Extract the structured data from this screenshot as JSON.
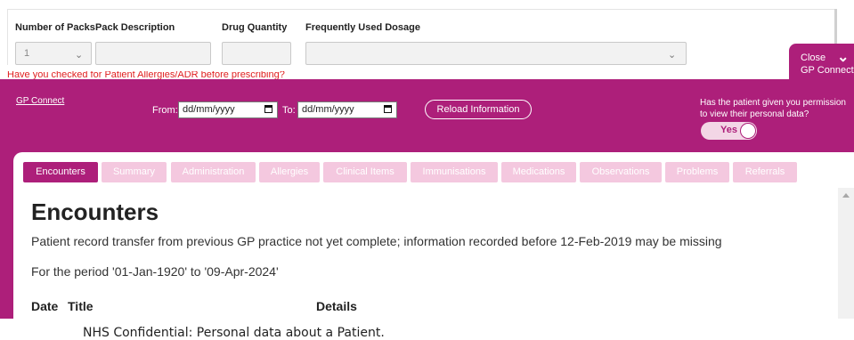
{
  "form": {
    "labels": {
      "packs": "Number of Packs",
      "description": "Pack Description",
      "quantity": "Drug Quantity",
      "dosage": "Frequently Used Dosage"
    },
    "packs_value": "1",
    "description_value": "",
    "quantity_value": "",
    "dosage_value": ""
  },
  "warning": "Have you checked for Patient Allergies/ADR before prescribing?",
  "close_tab": {
    "line1": "Close",
    "line2": "GP Connect"
  },
  "gp_panel": {
    "link": "GP Connect",
    "from_label": "From:",
    "to_label": "To:",
    "from_placeholder": "dd/mm/yyyy",
    "to_placeholder": "dd/mm/yyyy",
    "reload": "Reload Information",
    "permission": "Has the patient given you permission to view their personal data?",
    "toggle": "Yes"
  },
  "tabs": [
    "Encounters",
    "Summary",
    "Administration",
    "Allergies",
    "Clinical Items",
    "Immunisations",
    "Medications",
    "Observations",
    "Problems",
    "Referrals"
  ],
  "content": {
    "heading": "Encounters",
    "notice": "Patient record transfer from previous GP practice not yet complete; information recorded before 12-Feb-2019 may be missing",
    "period": "For the period '01-Jan-1920' to '09-Apr-2024'",
    "columns": [
      "Date",
      "Title",
      "Details"
    ]
  },
  "footer": "NHS Confidential: Personal data about a Patient.",
  "colors": {
    "accent": "#ad1f7a",
    "tab_inactive": "#f4c8df",
    "warning": "#e02020"
  }
}
